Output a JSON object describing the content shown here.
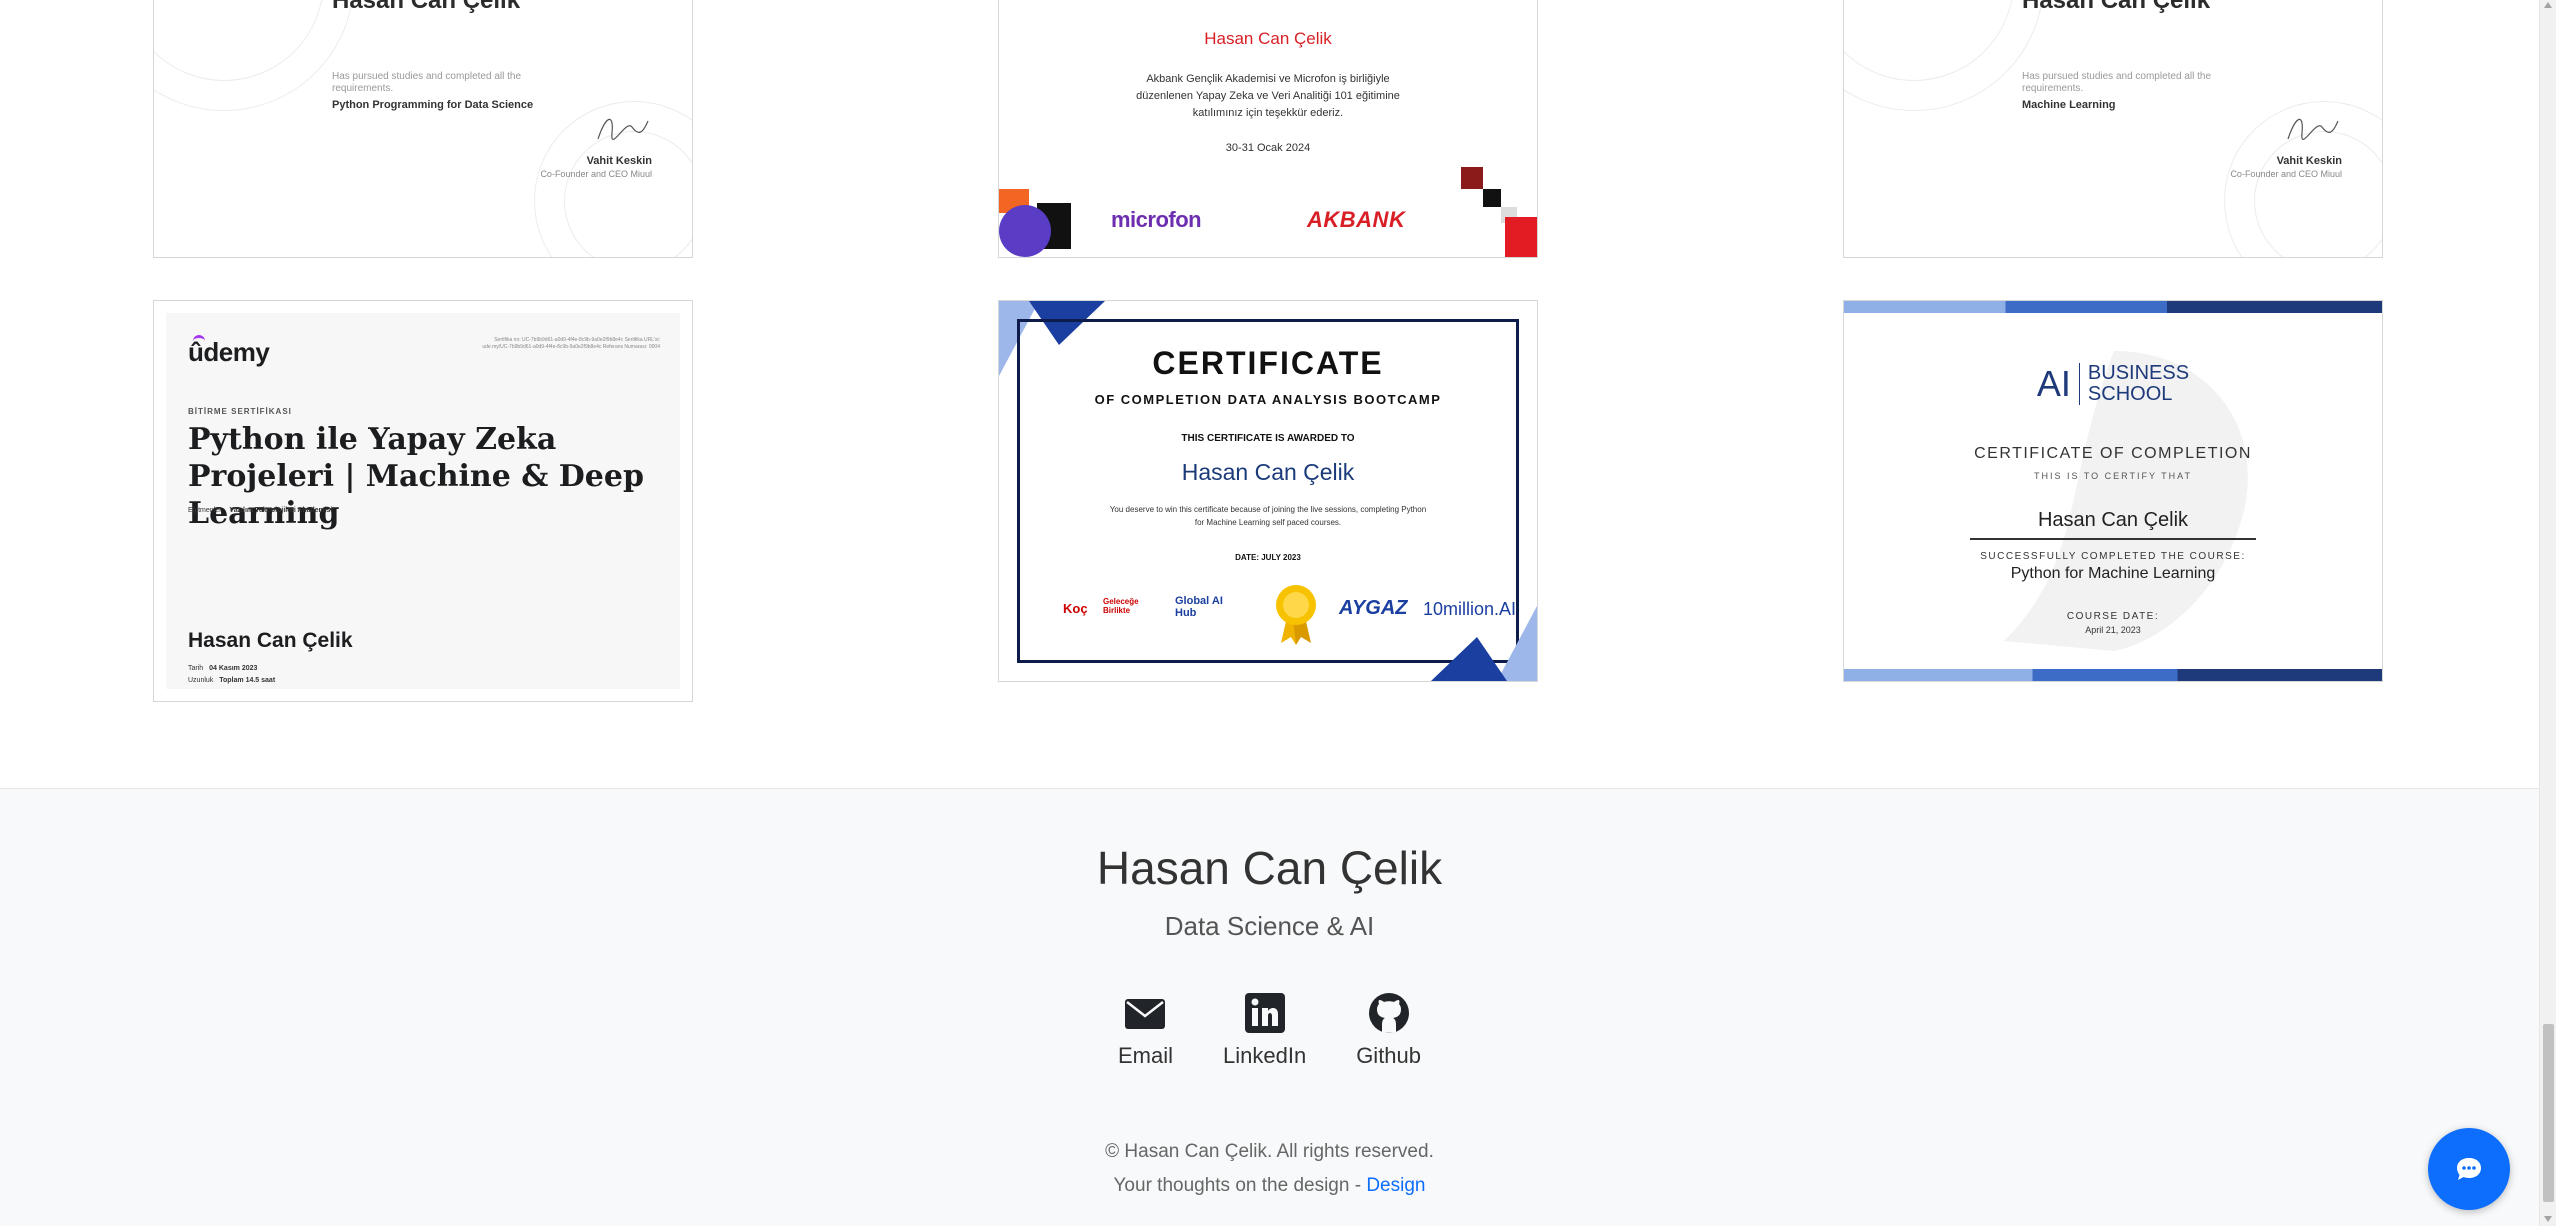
{
  "certificates": {
    "miuul_python": {
      "name": "Hasan Can Çelik",
      "text": "Has pursued studies and completed all the requirements.",
      "course": "Python Programming for Data Science",
      "signer": "Vahit Keskin",
      "role": "Co-Founder and CEO Miuul"
    },
    "akbank": {
      "name": "Hasan Can Çelik",
      "text": "Akbank Gençlik Akademisi ve Microfon iş birliğiyle düzenlenen Yapay Zeka ve Veri Analitiği 101 eğitimine katılımınız için teşekkür ederiz.",
      "date": "30-31 Ocak 2024",
      "logo_left": "microfon",
      "logo_right": "AKBANK"
    },
    "miuul_ml": {
      "name": "Hasan Can Çelik",
      "text": "Has pursued studies and completed all the requirements.",
      "course": "Machine Learning",
      "signer": "Vahit Keskin",
      "role": "Co-Founder and CEO Miuul"
    },
    "udemy": {
      "logo": "ûdemy",
      "refs": "Sertifika no: UC-7b9b9d61-a0d9-4f4e-8c9b-9a0e2f9b8e4c Sertifika URL'si: ude.my/UC-7b9b9d61-a0d9-4f4e-8c9b-9a0e2f9b8e4c Referans Numarası: 0004",
      "kicker": "BİTİRME SERTİFİKASI",
      "title": "Python ile Yapay Zeka Projeleri | Machine & Deep Learning",
      "instructor_label": "Eğitmenler",
      "instructor": "Yazılım Teknolojileri Akademisi",
      "person": "Hasan Can Çelik",
      "date_label": "Tarih",
      "date": "04 Kasım 2023",
      "length_label": "Uzunluk",
      "length": "Toplam 14.5 saat"
    },
    "globalaihub": {
      "title": "CERTIFICATE",
      "subtitle": "OF COMPLETION DATA ANALYSIS BOOTCAMP",
      "awarded": "THIS CERTIFICATE IS AWARDED TO",
      "name": "Hasan Can Çelik",
      "body": "You deserve to win this certificate because of joining the live sessions, completing Python for Machine Learning self paced courses.",
      "date": "DATE: JULY 2023",
      "logo_koc": "Koç",
      "logo_gelecek": "Geleceğe Birlikte",
      "logo_hub": "Global AI Hub",
      "logo_aygaz": "AYGAZ",
      "logo_10m": "10million.AI"
    },
    "aibs": {
      "logo_ai": "AI",
      "logo_business": "BUSINESS",
      "logo_school": "SCHOOL",
      "certificate": "CERTIFICATE OF COMPLETION",
      "certify": "THIS IS TO CERTIFY THAT",
      "name": "Hasan Can Çelik",
      "completed": "SUCCESSFULLY COMPLETED THE COURSE:",
      "course": "Python for Machine Learning",
      "date_label": "COURSE DATE:",
      "date": "April 21, 2023"
    }
  },
  "footer": {
    "name": "Hasan Can Çelik",
    "tagline": "Data Science & AI",
    "links": [
      {
        "label": "Email",
        "icon": "envelope-icon"
      },
      {
        "label": "LinkedIn",
        "icon": "linkedin-icon"
      },
      {
        "label": "Github",
        "icon": "github-icon"
      }
    ],
    "copyright": "© Hasan Can Çelik. All rights reserved.",
    "thoughts": "Your thoughts on the design - ",
    "design_link": "Design"
  },
  "colors": {
    "accent": "#0d6efd",
    "akbank_red": "#d81f26",
    "microfon_purple": "#6d2fb0",
    "hub_navy": "#0d1c4a",
    "aibs_blue": "#1e3a7a"
  },
  "chat_button": {
    "icon": "chat-bubble-icon"
  }
}
